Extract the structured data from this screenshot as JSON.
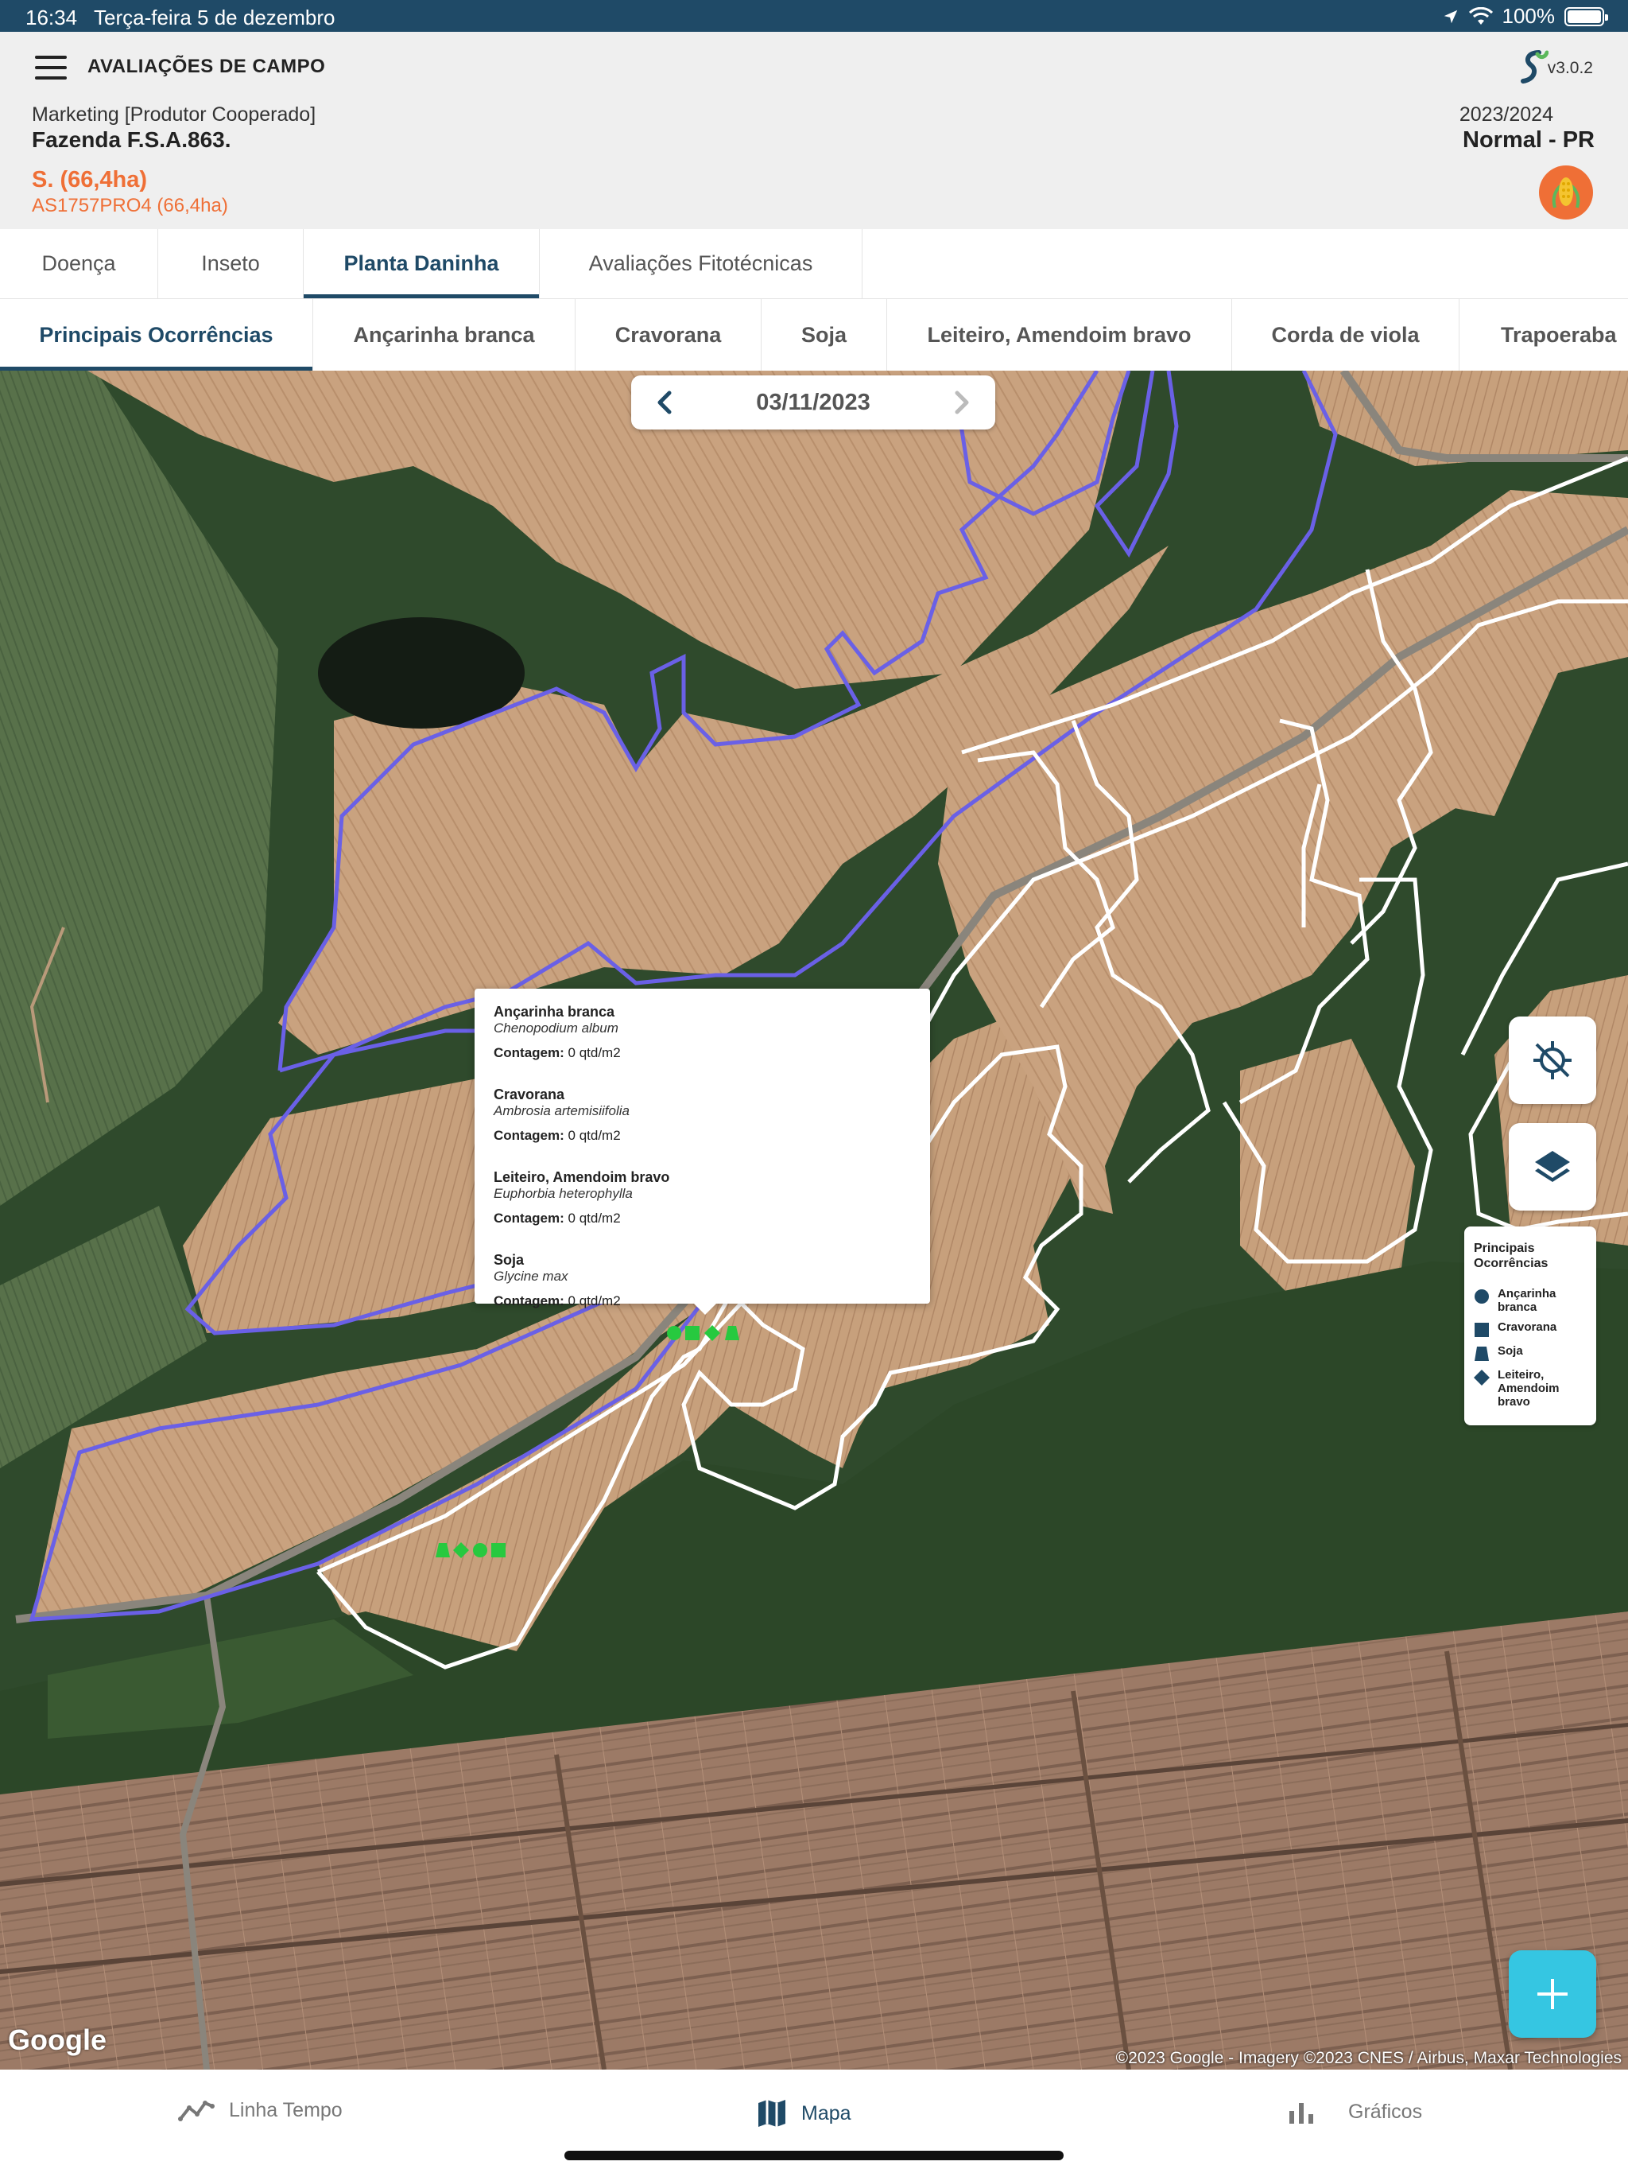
{
  "status_bar": {
    "time": "16:34",
    "date": "Terça-feira 5 de dezembro",
    "battery": "100%"
  },
  "header": {
    "app_title": "AVALIAÇÕES DE CAMPO",
    "version": "v3.0.2",
    "role": "Marketing [Produtor Cooperado]",
    "farm": "Fazenda F.S.A.863.",
    "field": "S. (66,4ha)",
    "field_sub": "AS1757PRO4 (66,4ha)",
    "season": "2023/2024",
    "region": "Normal - PR",
    "crop_icon": "corn-icon"
  },
  "tabs_primary": [
    {
      "label": "Doença"
    },
    {
      "label": "Inseto"
    },
    {
      "label": "Planta Daninha"
    },
    {
      "label": "Avaliações Fitotécnicas"
    }
  ],
  "tabs_secondary": [
    {
      "label": "Principais Ocorrências"
    },
    {
      "label": "Ançarinha branca"
    },
    {
      "label": "Cravorana"
    },
    {
      "label": "Soja"
    },
    {
      "label": "Leiteiro, Amendoim bravo"
    },
    {
      "label": "Corda de viola"
    },
    {
      "label": "Trapoeraba"
    }
  ],
  "map": {
    "date": "03/11/2023",
    "popup": [
      {
        "name": "Ançarinha branca",
        "scientific": "Chenopodium album",
        "count_label": "Contagem:",
        "count_value": "0 qtd/m2"
      },
      {
        "name": "Cravorana",
        "scientific": "Ambrosia artemisiifolia",
        "count_label": "Contagem:",
        "count_value": "0 qtd/m2"
      },
      {
        "name": "Leiteiro, Amendoim bravo",
        "scientific": "Euphorbia heterophylla",
        "count_label": "Contagem:",
        "count_value": "0 qtd/m2"
      },
      {
        "name": "Soja",
        "scientific": "Glycine max",
        "count_label": "Contagem:",
        "count_value": "0 qtd/m2"
      }
    ],
    "legend": {
      "title": "Principais Ocorrências",
      "items": [
        {
          "label": "Ançarinha branca",
          "symbol": "circle"
        },
        {
          "label": "Cravorana",
          "symbol": "square"
        },
        {
          "label": "Soja",
          "symbol": "trapezoid"
        },
        {
          "label": "Leiteiro, Amendoim bravo",
          "symbol": "diamond"
        }
      ]
    },
    "marker_color": "#27c93f",
    "google_logo": "Google",
    "attribution": "©2023 Google - Imagery ©2023 CNES / Airbus, Maxar Technologies"
  },
  "bottom_nav": [
    {
      "label": "Linha Tempo",
      "icon": "timeline-icon"
    },
    {
      "label": "Mapa",
      "icon": "map-icon"
    },
    {
      "label": "Gráficos",
      "icon": "bar-chart-icon"
    }
  ],
  "colors": {
    "primary": "#1f4a67",
    "accent": "#ef6f36",
    "fab": "#35c6e2",
    "field_outline": "#6a60e6"
  }
}
